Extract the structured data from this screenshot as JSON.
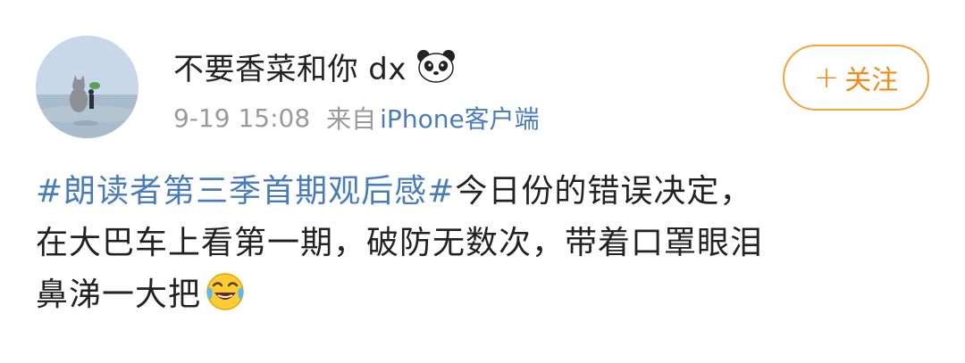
{
  "post": {
    "author": {
      "name": "不要香菜和你 dx",
      "badge_icon": "panda-emoji-icon"
    },
    "meta": {
      "time": "9-19 15:08",
      "via": "来自",
      "client": "iPhone客户端"
    },
    "follow_button": {
      "icon": "+",
      "label": "关注"
    },
    "content": {
      "hashtag": "#朗读者第三季首期观后感#",
      "line1": "今日份的错误决定，",
      "line2": "在大巴车上看第一期，破防无数次，带着口罩眼泪",
      "line3": "鼻涕一大把",
      "emoji": "crying-laughing-emoji-icon"
    }
  },
  "colors": {
    "link": "#4a7cba",
    "follow_accent": "#f38a17",
    "meta_gray": "#9a9a9a"
  }
}
